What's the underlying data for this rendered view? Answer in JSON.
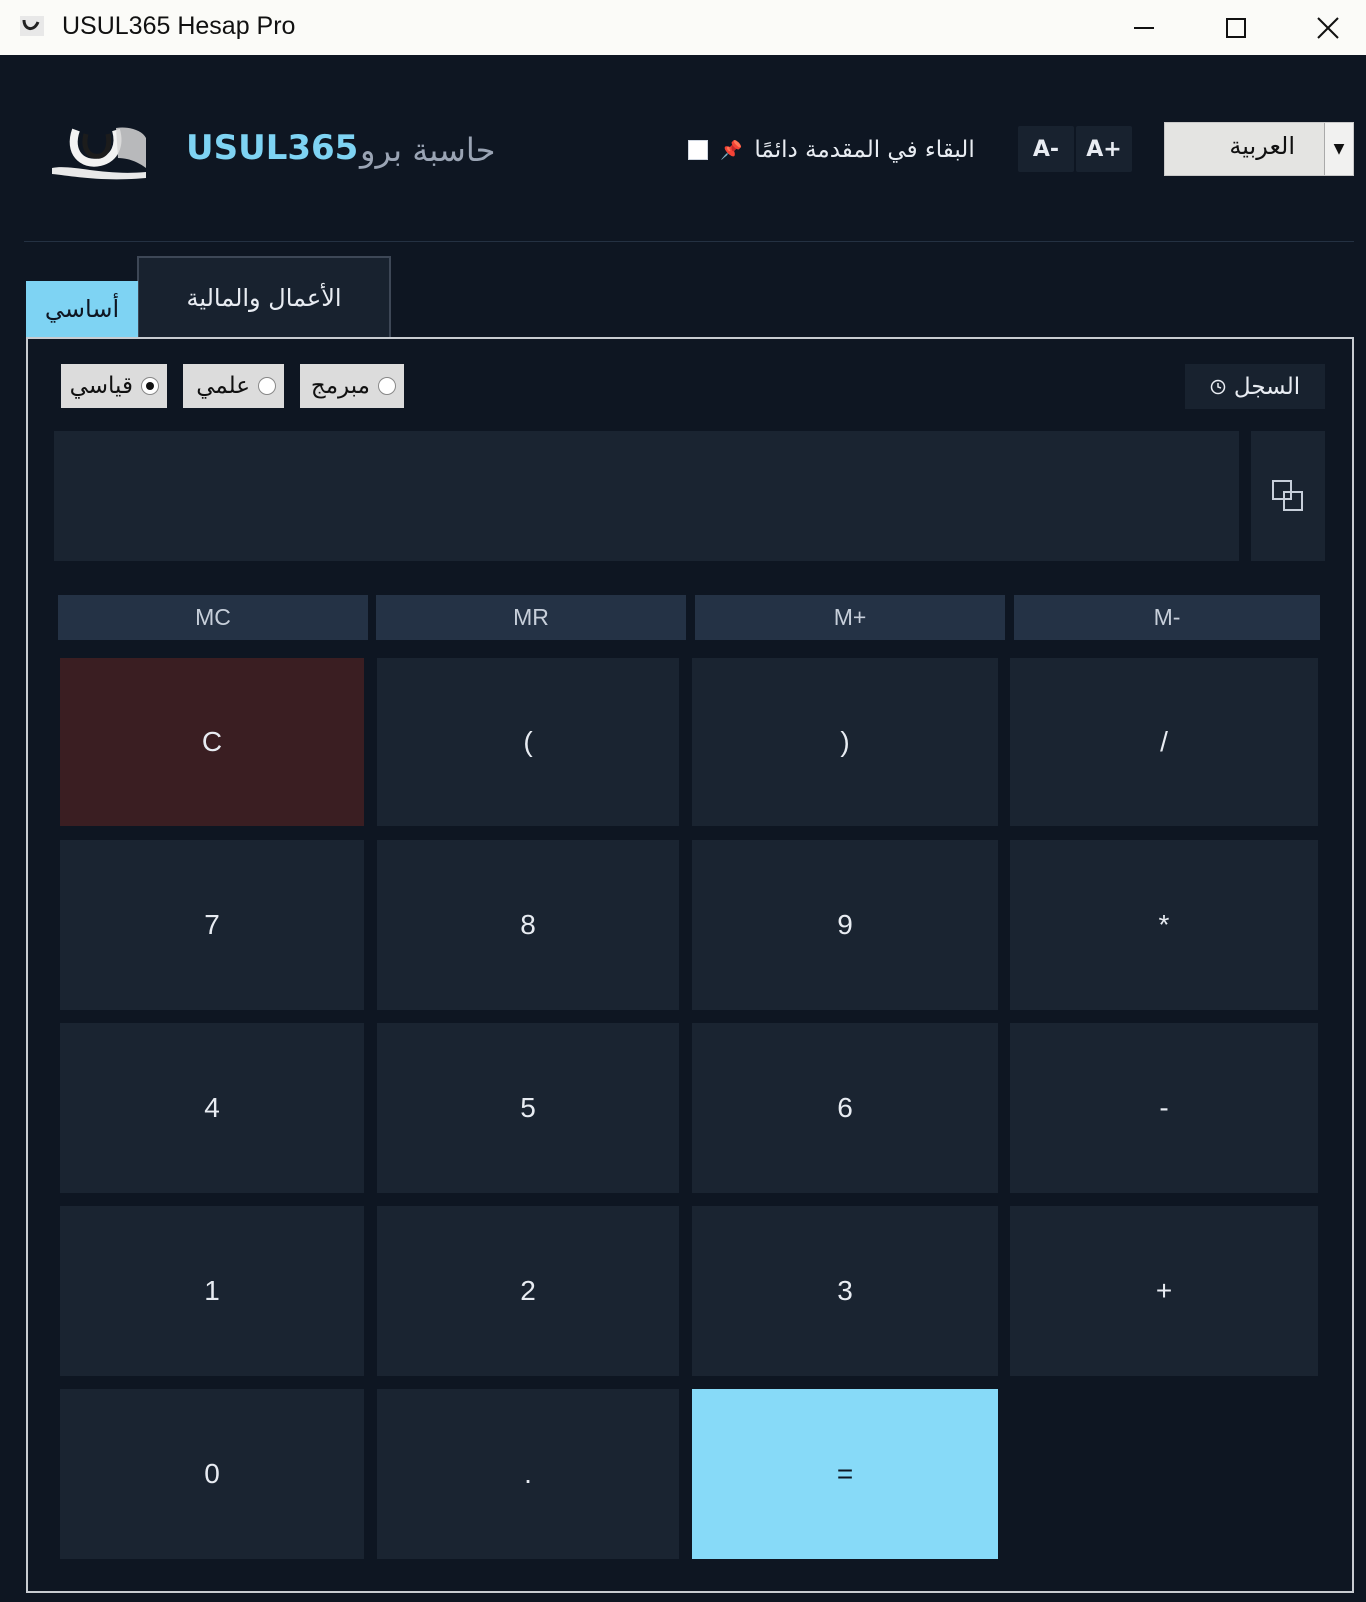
{
  "window": {
    "title": "USUL365 Hesap Pro"
  },
  "header": {
    "brand": "USUL365",
    "subtitle": "حاسبة برو",
    "always_on_top_label": "البقاء في المقدمة دائمًا",
    "always_on_top_checked": false,
    "font_decrease": "A-",
    "font_increase": "A+",
    "language_selected": "العربية"
  },
  "tabs": [
    {
      "label": "أساسي",
      "active": true
    },
    {
      "label": "الأعمال والمالية",
      "active": false
    }
  ],
  "modes": [
    {
      "label": "قياسي",
      "selected": true
    },
    {
      "label": "علمي",
      "selected": false
    },
    {
      "label": "مبرمج",
      "selected": false
    }
  ],
  "history_label": "السجل",
  "display_value": "",
  "memory": [
    "MC",
    "MR",
    "M+",
    "M-"
  ],
  "keys": {
    "clear": "C",
    "lparen": "(",
    "rparen": ")",
    "divide": "/",
    "seven": "7",
    "eight": "8",
    "nine": "9",
    "multiply": "*",
    "four": "4",
    "five": "5",
    "six": "6",
    "minus": "-",
    "one": "1",
    "two": "2",
    "three": "3",
    "plus": "+",
    "zero": "0",
    "dot": ".",
    "equals": "="
  },
  "colors": {
    "background": "#0e1622",
    "accent": "#7ed3f3",
    "key": "#1a2431",
    "clear_key": "#3a1e22",
    "equals_key": "#87daf8"
  }
}
